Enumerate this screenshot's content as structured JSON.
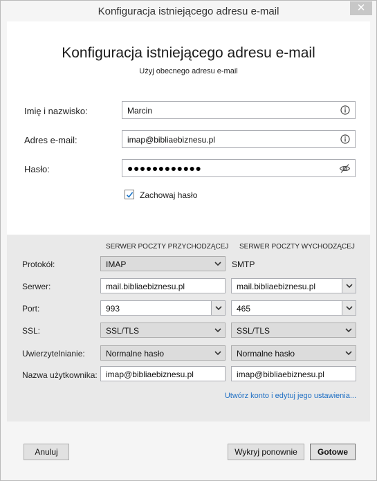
{
  "window": {
    "title": "Konfiguracja istniejącego adresu e-mail",
    "close_glyph": "✕"
  },
  "header": {
    "title": "Konfiguracja istniejącego adresu e-mail",
    "subtitle": "Użyj obecnego adresu e-mail"
  },
  "account": {
    "name_label": "Imię i nazwisko:",
    "name_value": "Marcin",
    "email_label": "Adres e-mail:",
    "email_value": "imap@bibliaebiznesu.pl",
    "password_label": "Hasło:",
    "password_value": "●●●●●●●●●●●●",
    "remember_label": "Zachowaj hasło",
    "remember_checked": true
  },
  "server": {
    "incoming_header": "SERWER POCZTY PRZYCHODZĄCEJ",
    "outgoing_header": "SERWER POCZTY WYCHODZĄCEJ",
    "protocol_label": "Protokół:",
    "server_label": "Serwer:",
    "port_label": "Port:",
    "ssl_label": "SSL:",
    "auth_label": "Uwierzytelnianie:",
    "username_label": "Nazwa użytkownika:",
    "incoming": {
      "protocol": "IMAP",
      "server": "mail.bibliaebiznesu.pl",
      "port": "993",
      "ssl": "SSL/TLS",
      "auth": "Normalne hasło",
      "username": "imap@bibliaebiznesu.pl"
    },
    "outgoing": {
      "protocol": "SMTP",
      "server": "mail.bibliaebiznesu.pl",
      "port": "465",
      "ssl": "SSL/TLS",
      "auth": "Normalne hasło",
      "username": "imap@bibliaebiznesu.pl"
    },
    "advanced_link": "Utwórz konto i edytuj jego ustawienia..."
  },
  "buttons": {
    "cancel": "Anuluj",
    "redetect": "Wykryj ponownie",
    "done": "Gotowe"
  },
  "colors": {
    "link": "#2070c4",
    "checkmark": "#1a73c6",
    "panel": "#e9e9e9"
  },
  "icons": [
    "info-icon",
    "eye-slash-icon",
    "chevron-down-icon",
    "checkmark-icon",
    "close-icon"
  ]
}
